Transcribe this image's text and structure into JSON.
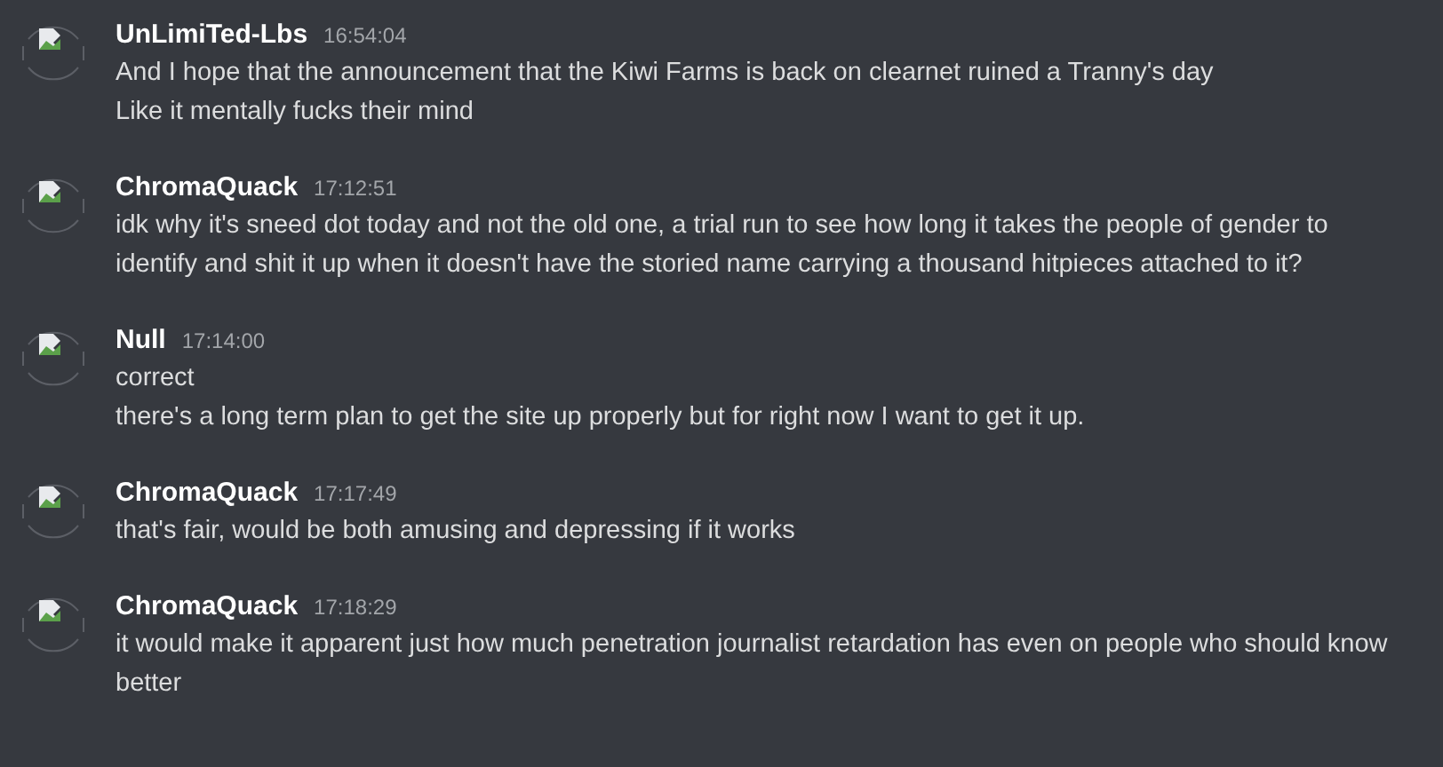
{
  "messages": [
    {
      "author": "UnLimiTed-Lbs",
      "time": "16:54:04",
      "lines": [
        "And I hope that the announcement that the Kiwi Farms is back on clearnet ruined a Tranny's day",
        "Like it mentally fucks their mind"
      ]
    },
    {
      "author": "ChromaQuack",
      "time": "17:12:51",
      "lines": [
        "idk why it's sneed dot today and not the old one, a trial run to see how long it takes the people of gender to identify and shit it up when it doesn't have the storied name carrying a thousand hitpieces attached to it?"
      ]
    },
    {
      "author": "Null",
      "time": "17:14:00",
      "lines": [
        "correct",
        "there's a long term plan to get the site up properly but for right now I want to get it up."
      ]
    },
    {
      "author": "ChromaQuack",
      "time": "17:17:49",
      "lines": [
        "that's fair, would be both amusing and depressing if it works"
      ]
    },
    {
      "author": "ChromaQuack",
      "time": "17:18:29",
      "lines": [
        "it would make it apparent just how much penetration journalist retardation has even on people who should know better"
      ]
    }
  ]
}
